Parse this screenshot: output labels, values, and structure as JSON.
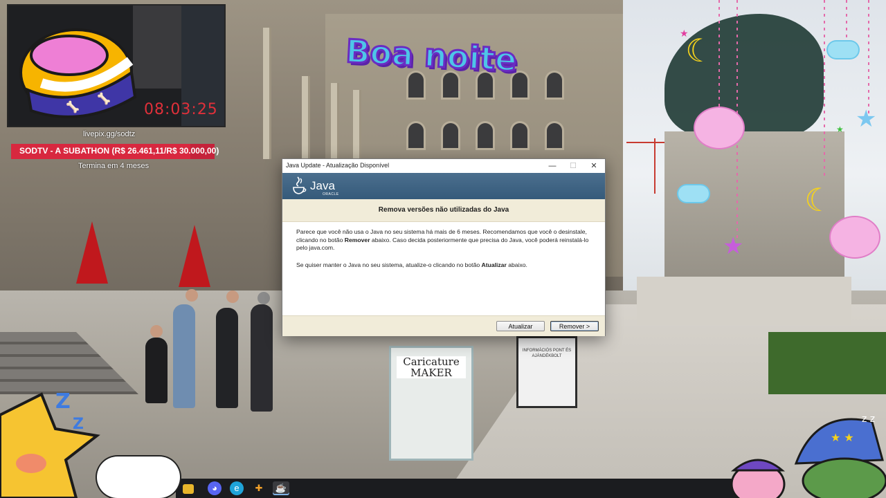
{
  "stream": {
    "timer": "08:03:25",
    "livepix": "livepix.gg/sodtz",
    "goal_text": "SODTV - A SUBATHON (R$ 26.461,11/R$ 30.000,00)",
    "goal_progress": 0.882,
    "goal_sub": "Termina em 4 meses",
    "greeting": "Boa noite"
  },
  "dialog": {
    "window_title": "Java Update - Atualização Disponível",
    "controls": {
      "minimize": "—",
      "maximize": "☐",
      "close": "✕"
    },
    "logo_word": "Java",
    "logo_sub": "ORACLE",
    "heading": "Remova versões não utilizadas do Java",
    "para1_a": "Parece que você não usa o Java no seu sistema há mais de 6 meses. Recomendamos que você o desinstale, clicando no botão ",
    "para1_bold": "Remover",
    "para1_b": " abaixo. Caso decida posteriormente que precisa do Java, você poderá reinstalá-lo pelo java.com.",
    "para2_a": "Se quiser manter o Java no seu sistema, atualize-o clicando no botão ",
    "para2_bold": "Atualizar",
    "para2_b": " abaixo.",
    "btn_update": "Atualizar",
    "btn_remove": "Remover >"
  },
  "scene": {
    "caricature_sign": "Caricature MAKER",
    "info_sign": "INFORMÁCIÓS PONT ÉS AJÁNDÉKBOLT"
  },
  "taskbar": {
    "icons": [
      "search-icon",
      "file-explorer-icon",
      "discord-icon",
      "edge-icon",
      "app-icon",
      "java-icon"
    ]
  },
  "colors": {
    "java_banner": "#3f6584",
    "heading_band": "#f1ecd9",
    "goal_bar": "#c5223a",
    "timer": "#e0303a"
  }
}
